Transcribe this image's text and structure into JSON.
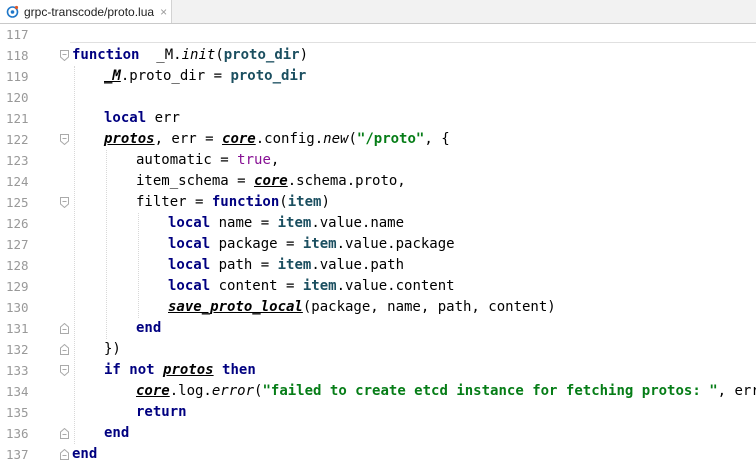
{
  "tab": {
    "title": "grpc-transcode/proto.lua",
    "close": "×",
    "icon": "lua-file-icon"
  },
  "lines": [
    {
      "n": "117",
      "fold": "",
      "indent": 0,
      "parts": []
    },
    {
      "n": "118",
      "fold": "open",
      "indent": 0,
      "parts": [
        [
          "kw",
          "function"
        ],
        [
          "",
          "  _M."
        ],
        [
          "it",
          "init"
        ],
        [
          "",
          "("
        ],
        [
          "param",
          "proto_dir"
        ],
        [
          "",
          ")"
        ]
      ]
    },
    {
      "n": "119",
      "fold": "",
      "indent": 1,
      "parts": [
        [
          "gl",
          "_M"
        ],
        [
          "",
          ".proto_dir = "
        ],
        [
          "param",
          "proto_dir"
        ]
      ]
    },
    {
      "n": "120",
      "fold": "",
      "indent": 0,
      "parts": []
    },
    {
      "n": "121",
      "fold": "",
      "indent": 1,
      "parts": [
        [
          "kw",
          "local"
        ],
        [
          "",
          " err"
        ]
      ]
    },
    {
      "n": "122",
      "fold": "open",
      "indent": 1,
      "parts": [
        [
          "gl",
          "protos"
        ],
        [
          "",
          ", err = "
        ],
        [
          "gl",
          "core"
        ],
        [
          "",
          ".config."
        ],
        [
          "it",
          "new"
        ],
        [
          "",
          "("
        ],
        [
          "str",
          "\"/proto\""
        ],
        [
          "",
          ", {"
        ]
      ]
    },
    {
      "n": "123",
      "fold": "",
      "indent": 2,
      "parts": [
        [
          "",
          "automatic = "
        ],
        [
          "bool",
          "true"
        ],
        [
          "",
          ","
        ]
      ]
    },
    {
      "n": "124",
      "fold": "",
      "indent": 2,
      "parts": [
        [
          "",
          "item_schema = "
        ],
        [
          "gl",
          "core"
        ],
        [
          "",
          ".schema.proto,"
        ]
      ]
    },
    {
      "n": "125",
      "fold": "open",
      "indent": 2,
      "parts": [
        [
          "",
          "filter = "
        ],
        [
          "kw",
          "function"
        ],
        [
          "",
          "("
        ],
        [
          "param",
          "item"
        ],
        [
          "",
          ")"
        ]
      ]
    },
    {
      "n": "126",
      "fold": "",
      "indent": 3,
      "parts": [
        [
          "kw",
          "local"
        ],
        [
          "",
          " name = "
        ],
        [
          "param",
          "item"
        ],
        [
          "",
          ".value.name"
        ]
      ]
    },
    {
      "n": "127",
      "fold": "",
      "indent": 3,
      "parts": [
        [
          "kw",
          "local"
        ],
        [
          "",
          " package = "
        ],
        [
          "param",
          "item"
        ],
        [
          "",
          ".value.package"
        ]
      ]
    },
    {
      "n": "128",
      "fold": "",
      "indent": 3,
      "parts": [
        [
          "kw",
          "local"
        ],
        [
          "",
          " path = "
        ],
        [
          "param",
          "item"
        ],
        [
          "",
          ".value.path"
        ]
      ]
    },
    {
      "n": "129",
      "fold": "",
      "indent": 3,
      "parts": [
        [
          "kw",
          "local"
        ],
        [
          "",
          " content = "
        ],
        [
          "param",
          "item"
        ],
        [
          "",
          ".value.content"
        ]
      ]
    },
    {
      "n": "130",
      "fold": "",
      "indent": 3,
      "parts": [
        [
          "gl",
          "save_proto_local"
        ],
        [
          "",
          "(package, name, path, content)"
        ]
      ]
    },
    {
      "n": "131",
      "fold": "close",
      "indent": 2,
      "parts": [
        [
          "kw",
          "end"
        ]
      ]
    },
    {
      "n": "132",
      "fold": "close",
      "indent": 1,
      "parts": [
        [
          "",
          "})"
        ]
      ]
    },
    {
      "n": "133",
      "fold": "open",
      "indent": 1,
      "parts": [
        [
          "kw",
          "if not"
        ],
        [
          "",
          " "
        ],
        [
          "gl",
          "protos"
        ],
        [
          "",
          " "
        ],
        [
          "kw",
          "then"
        ]
      ]
    },
    {
      "n": "134",
      "fold": "",
      "indent": 2,
      "parts": [
        [
          "gl",
          "core"
        ],
        [
          "",
          ".log."
        ],
        [
          "it",
          "error"
        ],
        [
          "",
          "("
        ],
        [
          "str",
          "\"failed to create etcd instance for fetching protos: \""
        ],
        [
          "",
          ", err)"
        ]
      ]
    },
    {
      "n": "135",
      "fold": "",
      "indent": 2,
      "parts": [
        [
          "kw",
          "return"
        ]
      ]
    },
    {
      "n": "136",
      "fold": "close",
      "indent": 1,
      "parts": [
        [
          "kw",
          "end"
        ]
      ]
    },
    {
      "n": "137",
      "fold": "close",
      "indent": 0,
      "parts": [
        [
          "kw",
          "end"
        ]
      ]
    }
  ]
}
